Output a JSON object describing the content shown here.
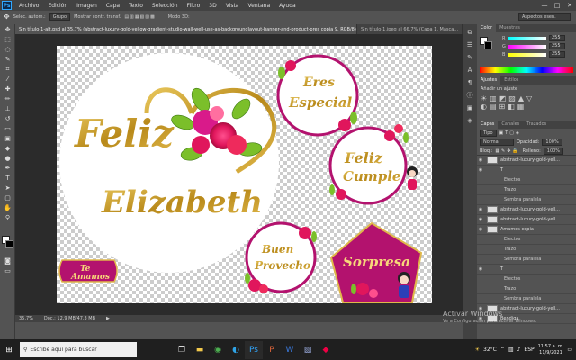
{
  "app": {
    "logo": "Ps"
  },
  "menu": [
    "Archivo",
    "Edición",
    "Imagen",
    "Capa",
    "Texto",
    "Selección",
    "Filtro",
    "3D",
    "Vista",
    "Ventana",
    "Ayuda"
  ],
  "window_controls": [
    "—",
    "□",
    "✕"
  ],
  "options": {
    "auto_select_label": "Selec. autom.:",
    "group_value": "Grupo",
    "show_transform": "Mostrar contr. transf.",
    "mode_3d": "Modo 3D:",
    "search_placeholder": "Aspectos esen."
  },
  "document_tabs": [
    "Sin título-1-alt.psd al 35,7% (abstract-luxury-gold-yellow-gradient-studio-wall-well-use-as-backgroundlayout-banner-and-product-pres copia 9, RGB/8) *",
    "Sin título-1.jpeg al 66,7% (Capa 1, Másca..."
  ],
  "artwork": {
    "feliz_line1": "Feliz",
    "feliz_line2": "Cumple",
    "name": "Elizabeth",
    "eres_line1": "Eres",
    "eres_line2": "Especial",
    "feliz_small_1": "Feliz",
    "feliz_small_2": "Cumple",
    "te_amamos_1": "Te",
    "te_amamos_2": "Amamos",
    "buen_1": "Buen",
    "buen_2": "Provecho",
    "sorpresa": "Sorpresa"
  },
  "status": {
    "zoom": "35,7%",
    "doc": "Doc.: 12,9 MB/47,3 MB"
  },
  "color_panel": {
    "tabs": [
      "Color",
      "Muestras"
    ],
    "sliders": [
      {
        "label": "R",
        "value": "255"
      },
      {
        "label": "G",
        "value": "255"
      },
      {
        "label": "B",
        "value": "255"
      }
    ]
  },
  "adjust_panel": {
    "tabs": [
      "Ajustes",
      "Estilos"
    ],
    "title": "Añadir un ajuste"
  },
  "layers_panel": {
    "tabs": [
      "Capas",
      "Canales",
      "Trazados"
    ],
    "kind_filter": "Tipo",
    "blend_mode": "Normal",
    "opacity_label": "Opacidad:",
    "opacity_value": "100%",
    "lock_label": "Bloq.:",
    "fill_label": "Relleno:",
    "fill_value": "100%",
    "rows": [
      {
        "text": "abstract-luxury-gold-yell...",
        "type": "layer"
      },
      {
        "text": "T",
        "type": "text"
      },
      {
        "text": "Efectos",
        "type": "sub"
      },
      {
        "text": "Trazo",
        "type": "sub"
      },
      {
        "text": "Sombra paralela",
        "type": "sub"
      },
      {
        "text": "abstract-luxury-gold-yell...",
        "type": "layer"
      },
      {
        "text": "abstract-luxury-gold-yell...",
        "type": "layer"
      },
      {
        "text": "Amamos copia",
        "type": "layer"
      },
      {
        "text": "Efectos",
        "type": "sub"
      },
      {
        "text": "Trazo",
        "type": "sub"
      },
      {
        "text": "Sombra paralela",
        "type": "sub"
      },
      {
        "text": "T",
        "type": "text"
      },
      {
        "text": "Efectos",
        "type": "sub"
      },
      {
        "text": "Trazo",
        "type": "sub"
      },
      {
        "text": "Sombra paralela",
        "type": "sub"
      },
      {
        "text": "abstract-luxury-gold-yell...",
        "type": "layer"
      },
      {
        "text": "Bendiga",
        "type": "layer"
      }
    ]
  },
  "watermark": {
    "title": "Activar Windows",
    "subtitle": "Ve a Configuración para activar Windows."
  },
  "taskbar": {
    "search_placeholder": "Escribe aquí para buscar",
    "temperature": "32°C",
    "language": "ESP",
    "time": "11:57 a. m.",
    "date": "11/9/2021"
  },
  "colors": {
    "magenta": "#c8177a",
    "gold": "#c9a227",
    "ps_blue": "#31a8ff"
  }
}
